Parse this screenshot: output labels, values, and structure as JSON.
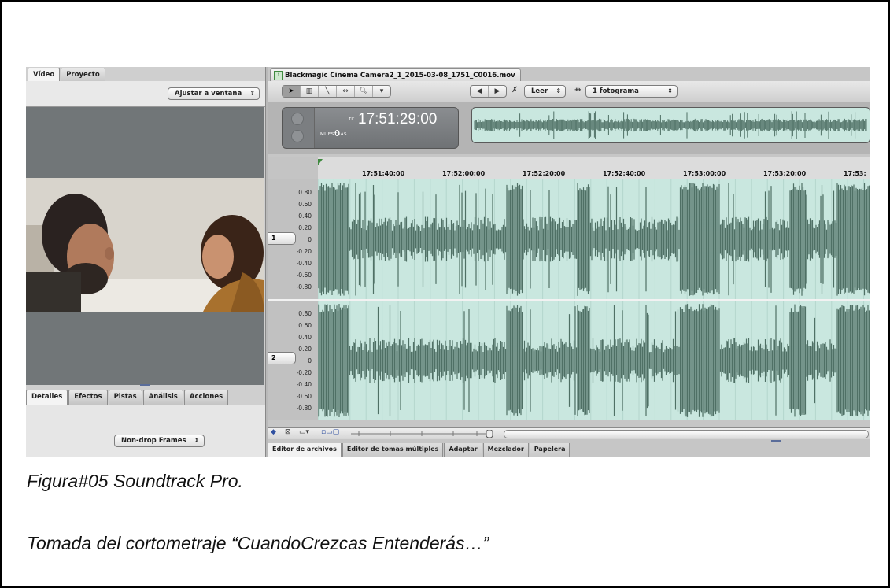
{
  "left_panel": {
    "top_tabs": [
      "Vídeo",
      "Proyecto"
    ],
    "fit_select": "Ajustar a ventana",
    "bottom_tabs": [
      "Detalles",
      "Efectos",
      "Pistas",
      "Análisis",
      "Acciones"
    ],
    "timecode_format_select": "Non-drop Frames"
  },
  "editor": {
    "file_tab": "Blackmagic Cinema Camera2_1_2015-03-08_1751_C0016.mov",
    "tools": [
      "arrow-icon",
      "scrub-icon",
      "pencil-icon",
      "timeslice-icon",
      "zoom-icon",
      "tool-menu-icon"
    ],
    "transport": [
      "rewind-icon",
      "play-icon"
    ],
    "read_select": "Leer",
    "nudge_select": "1 fotograma",
    "timecode_label": "TC",
    "timecode": "17:51:29:00",
    "samples_label": "MUESTRAS",
    "samples_value": "0",
    "ruler_ticks": [
      "17:51:40:00",
      "17:52:00:00",
      "17:52:20:00",
      "17:52:40:00",
      "17:53:00:00",
      "17:53:20:00",
      "17:53:"
    ],
    "amplitude_labels": [
      "0.80",
      "0.60",
      "0.40",
      "0.20",
      "0",
      "-0.20",
      "-0.40",
      "-0.60",
      "-0.80"
    ],
    "tracks": [
      "1",
      "2"
    ],
    "bottom_tabs": [
      "Editor de archivos",
      "Editor de tomas múltiples",
      "Adaptar",
      "Mezclador",
      "Papelera"
    ]
  },
  "captions": {
    "figure": "Figura#05 Soundtrack Pro.",
    "source": "Tomada del cortometraje “CuandoCrezcas Entenderás…”"
  },
  "colors": {
    "waveform": "#4f7065",
    "waveform_bg": "#c9e7df"
  }
}
